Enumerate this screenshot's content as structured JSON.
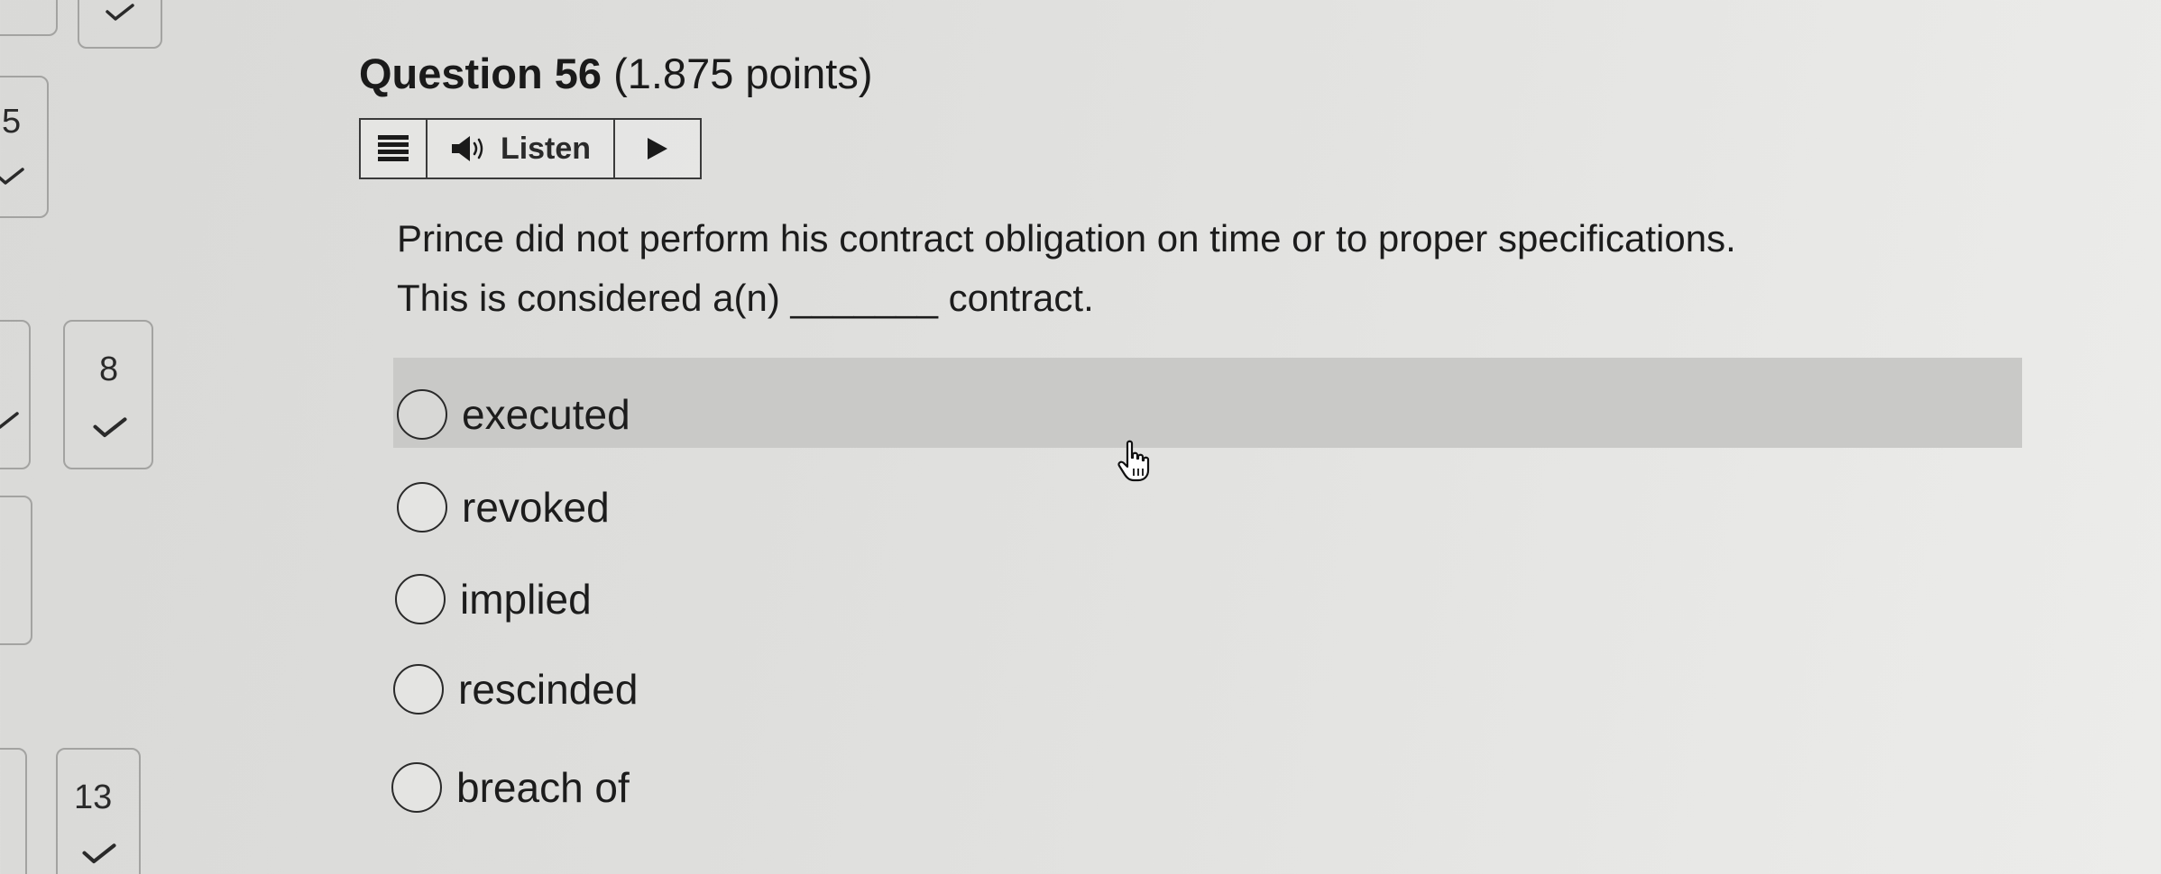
{
  "navigator": {
    "tiles": [
      {
        "number": "",
        "answered": true
      },
      {
        "number": "5",
        "answered": true
      },
      {
        "number": "8",
        "answered": true
      },
      {
        "number": "13",
        "answered": true
      }
    ]
  },
  "question": {
    "label": "Question 56",
    "points": "(1.875 points)",
    "prompt_line1": "Prince did not perform his contract obligation on time or to proper specifications.",
    "prompt_line2": "This is considered a(n) _______ contract."
  },
  "listen_toolbar": {
    "listen_label": "Listen",
    "icons": [
      "menu-icon",
      "speaker-icon",
      "play-icon"
    ]
  },
  "options": [
    {
      "label": "executed",
      "selected": false,
      "hovered": true
    },
    {
      "label": "revoked",
      "selected": false,
      "hovered": false
    },
    {
      "label": "implied",
      "selected": false,
      "hovered": false
    },
    {
      "label": "rescinded",
      "selected": false,
      "hovered": false
    },
    {
      "label": "breach of",
      "selected": false,
      "hovered": false
    }
  ]
}
